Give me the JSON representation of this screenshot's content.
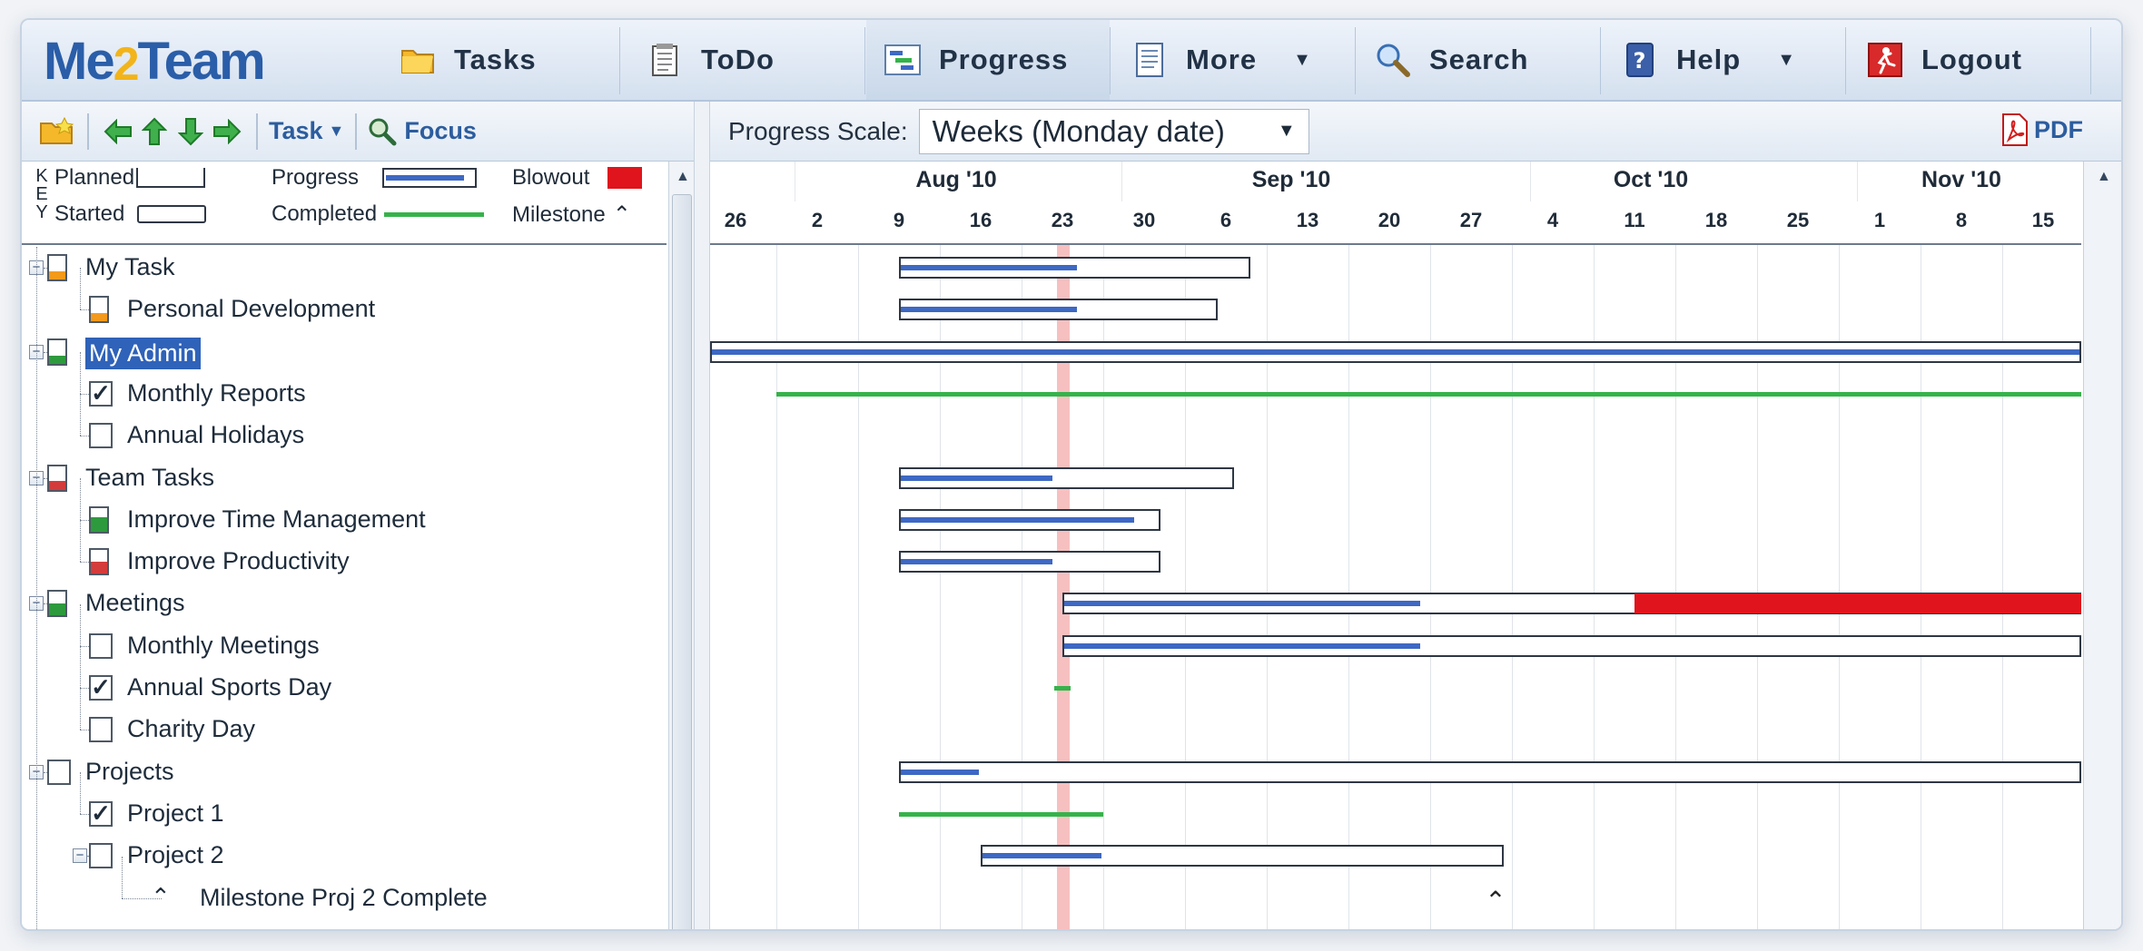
{
  "app": {
    "logo": [
      "Me",
      "2",
      "Team"
    ],
    "nav": [
      {
        "id": "tasks",
        "label": "Tasks",
        "icon": "folder-icon"
      },
      {
        "id": "todo",
        "label": "ToDo",
        "icon": "notepad-icon"
      },
      {
        "id": "progress",
        "label": "Progress",
        "icon": "chart-icon",
        "active": true
      },
      {
        "id": "more",
        "label": "More",
        "icon": "document-icon",
        "dropdown": true
      },
      {
        "id": "search",
        "label": "Search",
        "icon": "magnifier-icon"
      },
      {
        "id": "help",
        "label": "Help",
        "icon": "help-book-icon",
        "dropdown": true
      },
      {
        "id": "logout",
        "label": "Logout",
        "icon": "exit-icon"
      }
    ]
  },
  "toolbar": {
    "task_label": "Task",
    "focus_label": "Focus",
    "scale_label": "Progress Scale:",
    "scale_value": "Weeks (Monday date)",
    "pdf_label": "PDF"
  },
  "legend": {
    "key_letters": [
      "K",
      "E",
      "Y"
    ],
    "planned": "Planned",
    "progress": "Progress",
    "blowout": "Blowout",
    "started": "Started",
    "completed": "Completed",
    "milestone": "Milestone"
  },
  "tree": [
    {
      "label": "My Task",
      "level": 0,
      "icon": "task",
      "fill": 0.35,
      "fill_color": "#f39a1d",
      "expander": true
    },
    {
      "label": "Personal Development",
      "level": 1,
      "icon": "task",
      "fill": 0.35,
      "fill_color": "#f39a1d"
    },
    {
      "label": "My Admin",
      "level": 0,
      "icon": "task",
      "fill": 0.35,
      "fill_color": "#2e9a3e",
      "expander": true,
      "selected": true
    },
    {
      "label": "Monthly Reports",
      "level": 1,
      "icon": "check",
      "checked": true
    },
    {
      "label": "Annual Holidays",
      "level": 1,
      "icon": "check",
      "checked": false
    },
    {
      "label": "Team Tasks",
      "level": 0,
      "icon": "task",
      "fill": 0.35,
      "fill_color": "#d43b3b",
      "expander": true
    },
    {
      "label": "Improve Time Management",
      "level": 1,
      "icon": "task",
      "fill": 0.6,
      "fill_color": "#2e9a3e"
    },
    {
      "label": "Improve Productivity",
      "level": 1,
      "icon": "task",
      "fill": 0.5,
      "fill_color": "#d43b3b"
    },
    {
      "label": "Meetings",
      "level": 0,
      "icon": "task",
      "fill": 0.5,
      "fill_color": "#2e9a3e",
      "expander": true
    },
    {
      "label": "Monthly Meetings",
      "level": 1,
      "icon": "check",
      "checked": false
    },
    {
      "label": "Annual Sports Day",
      "level": 1,
      "icon": "check",
      "checked": true
    },
    {
      "label": "Charity Day",
      "level": 1,
      "icon": "check",
      "checked": false
    },
    {
      "label": "Projects",
      "level": 0,
      "icon": "check",
      "checked": false,
      "expander": true
    },
    {
      "label": "Project 1",
      "level": 1,
      "icon": "check",
      "checked": true
    },
    {
      "label": "Project 2",
      "level": 1,
      "icon": "check",
      "checked": false,
      "expander": true
    },
    {
      "label": "Milestone Proj 2 Complete",
      "level": 2,
      "icon": "milestone"
    }
  ],
  "timeline": {
    "months": [
      "Aug '10",
      "Sep '10",
      "Oct '10",
      "Nov '10"
    ],
    "weeks": [
      "26",
      "2",
      "9",
      "16",
      "23",
      "30",
      "6",
      "13",
      "20",
      "27",
      "4",
      "11",
      "18",
      "25",
      "1",
      "8",
      "15"
    ],
    "today_week_index": 4.0
  },
  "gantt_rows": [
    {
      "row": 0,
      "type": "planned",
      "start": 2.0,
      "end": 6.3,
      "progress_end": 4.2
    },
    {
      "row": 1,
      "type": "planned",
      "start": 2.0,
      "end": 5.9,
      "progress_end": 4.2
    },
    {
      "row": 2,
      "type": "planned",
      "start": -1.0,
      "end": 17.0,
      "progress_end": 17.0
    },
    {
      "row": 3,
      "type": "completed",
      "start": 0.5,
      "end": 17.0
    },
    {
      "row": 5,
      "type": "planned",
      "start": 2.0,
      "end": 6.1,
      "progress_end": 3.9
    },
    {
      "row": 6,
      "type": "planned",
      "start": 2.0,
      "end": 5.2,
      "progress_end": 4.9
    },
    {
      "row": 7,
      "type": "planned",
      "start": 2.0,
      "end": 5.2,
      "progress_end": 3.9
    },
    {
      "row": 8,
      "type": "planned",
      "start": 4.0,
      "end": 11.0,
      "progress_end": 8.4,
      "blowout_end": 17.0
    },
    {
      "row": 9,
      "type": "planned",
      "start": 4.0,
      "end": 17.0,
      "progress_end": 8.4
    },
    {
      "row": 10,
      "type": "completed",
      "start": 3.9,
      "end": 4.1
    },
    {
      "row": 12,
      "type": "planned",
      "start": 2.0,
      "end": 17.0,
      "progress_end": 3.0
    },
    {
      "row": 13,
      "type": "completed",
      "start": 2.0,
      "end": 4.5
    },
    {
      "row": 14,
      "type": "planned",
      "start": 3.0,
      "end": 9.4,
      "progress_end": 4.5
    },
    {
      "row": 15,
      "type": "milestone",
      "at": 9.3
    }
  ]
}
